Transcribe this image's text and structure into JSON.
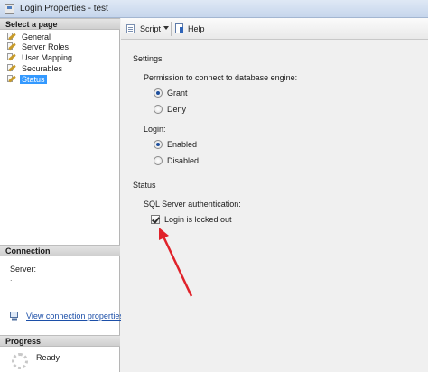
{
  "window": {
    "title": "Login Properties - test"
  },
  "sidebar": {
    "header": "Select a page",
    "items": [
      {
        "label": "General"
      },
      {
        "label": "Server Roles"
      },
      {
        "label": "User Mapping"
      },
      {
        "label": "Securables"
      },
      {
        "label": "Status"
      }
    ],
    "selected": "Status"
  },
  "connection": {
    "header": "Connection",
    "server_label": "Server:",
    "server_value": ".",
    "view_link": "View connection properties"
  },
  "progress": {
    "header": "Progress",
    "status": "Ready"
  },
  "toolbar": {
    "script_label": "Script",
    "help_label": "Help"
  },
  "settings": {
    "title": "Settings",
    "permission_label": "Permission to connect to database engine:",
    "permission_options": [
      {
        "label": "Grant",
        "checked": true
      },
      {
        "label": "Deny",
        "checked": false
      }
    ],
    "login_label": "Login:",
    "login_options": [
      {
        "label": "Enabled",
        "checked": true
      },
      {
        "label": "Disabled",
        "checked": false
      }
    ]
  },
  "status": {
    "title": "Status",
    "auth_label": "SQL Server authentication:",
    "locked_out_label": "Login is locked out",
    "locked_out_checked": true
  },
  "colors": {
    "annotation_arrow": "#e0222a",
    "selection": "#3399ff",
    "link": "#1c4fa8"
  }
}
